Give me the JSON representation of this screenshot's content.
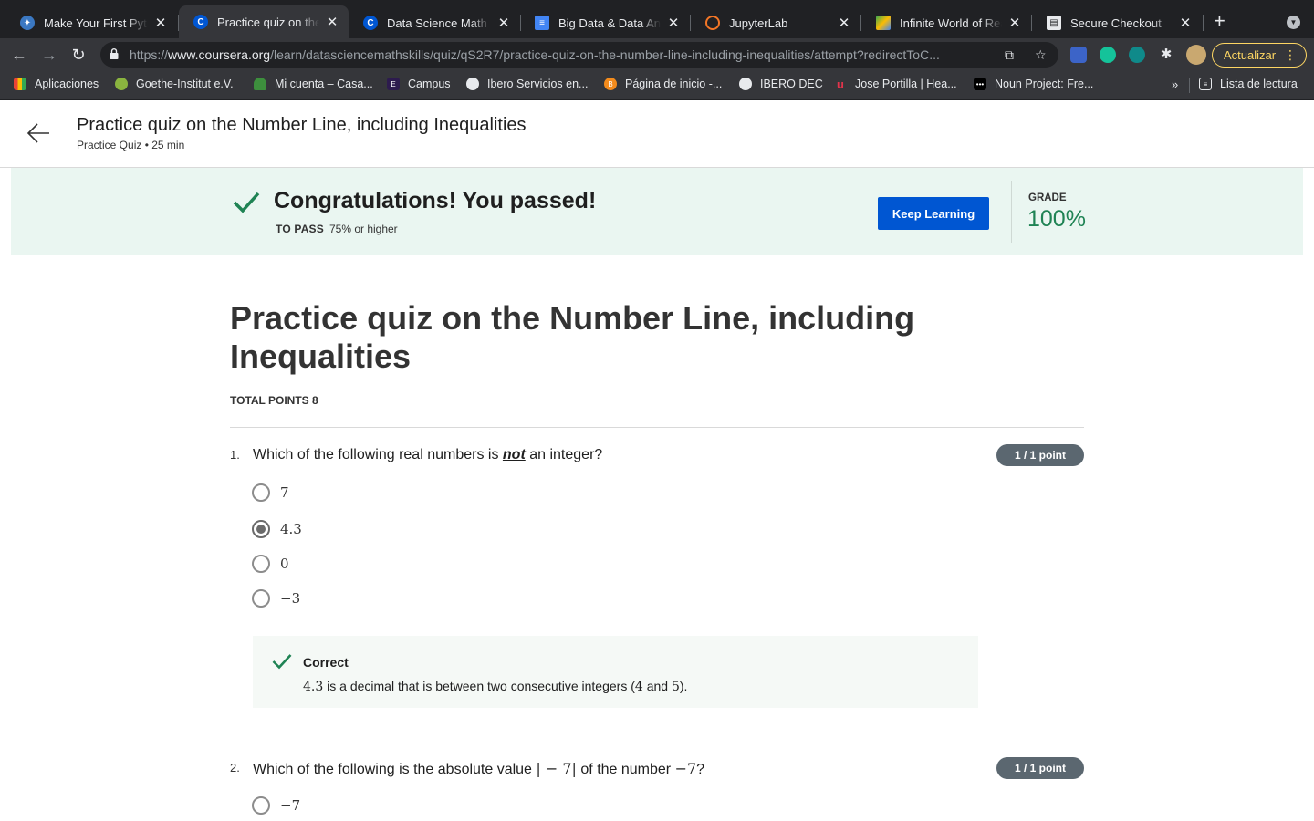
{
  "browser": {
    "tabs": [
      {
        "title": "Make Your First Python",
        "icon": "python-icon"
      },
      {
        "title": "Practice quiz on the Number Line",
        "icon": "coursera-icon"
      },
      {
        "title": "Data Science Math Skills",
        "icon": "coursera-icon"
      },
      {
        "title": "Big Data & Data Analytics",
        "icon": "docs-icon"
      },
      {
        "title": "JupyterLab",
        "icon": "jupyter-icon"
      },
      {
        "title": "Infinite World of Real",
        "icon": "drive-icon"
      },
      {
        "title": "Secure Checkout",
        "icon": "checkout-icon"
      }
    ],
    "url_scheme": "https://",
    "url_host": "www.coursera.org",
    "url_path": "/learn/datasciencemathskills/quiz/qS2R7/practice-quiz-on-the-number-line-including-inequalities/attempt?redirectToC...",
    "update_label": "Actualizar",
    "bookmarks": [
      {
        "label": "Aplicaciones"
      },
      {
        "label": "Goethe-Institut e.V."
      },
      {
        "label": "Mi cuenta – Casa..."
      },
      {
        "label": "Campus"
      },
      {
        "label": "Ibero Servicios en..."
      },
      {
        "label": "Página de inicio -..."
      },
      {
        "label": "IBERO DEC"
      },
      {
        "label": "Jose Portilla | Hea..."
      },
      {
        "label": "Noun Project: Fre..."
      }
    ],
    "reading_list_label": "Lista de lectura",
    "overflow_label": "»"
  },
  "header": {
    "title": "Practice quiz on the Number Line, including Inequalities",
    "subtitle": "Practice Quiz • 25 min"
  },
  "banner": {
    "title": "Congratulations! You passed!",
    "to_pass_label": "TO PASS",
    "to_pass_value": "75% or higher",
    "keep_learning_label": "Keep Learning",
    "grade_label": "GRADE",
    "grade_value": "100%",
    "success_color": "#1f8354",
    "button_color": "#0056d2"
  },
  "quiz": {
    "title": "Practice quiz on the Number Line, including Inequalities",
    "total_points_label": "TOTAL POINTS 8",
    "questions": [
      {
        "number": "1.",
        "text_before": "Which of the following real numbers is ",
        "text_emphasis": "not",
        "text_after": " an integer?",
        "points": "1 / 1 point",
        "options": [
          "7",
          "4.3",
          "0",
          "−3"
        ],
        "selected_index": 1,
        "feedback": {
          "status": "Correct",
          "value": "4.3",
          "text_mid": " is a decimal that is between two consecutive integers (",
          "a": "4",
          "and": " and ",
          "b": "5",
          "end": ")."
        }
      },
      {
        "number": "2.",
        "text_before": "Which of the following is the absolute value ",
        "math_abs": "| − 7|",
        "text_mid": " of the number ",
        "math_num": "−7",
        "text_after": "?",
        "points": "1 / 1 point",
        "options": [
          "−7"
        ]
      }
    ]
  }
}
